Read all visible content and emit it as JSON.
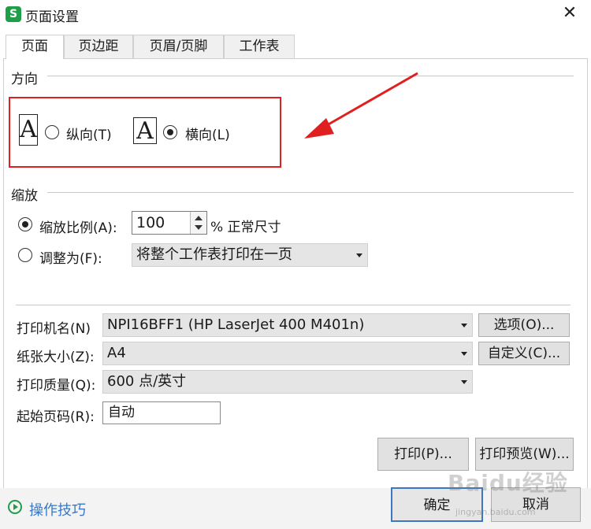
{
  "window": {
    "app_icon": "S",
    "title": "页面设置",
    "close_glyph": "✕"
  },
  "tabs": [
    {
      "label": "页面",
      "active": true
    },
    {
      "label": "页边距",
      "active": false
    },
    {
      "label": "页眉/页脚",
      "active": false
    },
    {
      "label": "工作表",
      "active": false
    }
  ],
  "orientation": {
    "title": "方向",
    "glyph": "A",
    "portrait_label": "纵向(T)",
    "landscape_label": "横向(L)",
    "selected": "landscape"
  },
  "scaling": {
    "title": "缩放",
    "scale_label": "缩放比例(A):",
    "scale_value": "100",
    "scale_suffix": "% 正常尺寸",
    "fit_label": "调整为(F):",
    "fit_option": "将整个工作表打印在一页",
    "selected": "scale"
  },
  "printer": {
    "label": "打印机名(N)",
    "value": "NPI16BFF1 (HP LaserJet 400 M401n)",
    "options_button": "选项(O)..."
  },
  "paper": {
    "label": "纸张大小(Z):",
    "value": "A4",
    "custom_button": "自定义(C)..."
  },
  "quality": {
    "label": "打印质量(Q):",
    "value": "600 点/英寸"
  },
  "start_page": {
    "label": "起始页码(R):",
    "value": "自动"
  },
  "actions": {
    "print": "打印(P)...",
    "preview": "打印预览(W)...",
    "ok": "确定",
    "cancel": "取消"
  },
  "footer": {
    "tips": "操作技巧"
  },
  "watermark": {
    "main": "Baidu经验",
    "sub": "jingyan.baidu.com"
  },
  "colors": {
    "highlight": "#e02020",
    "accent_green": "#1f9e4a",
    "link_blue": "#3a78c3"
  }
}
